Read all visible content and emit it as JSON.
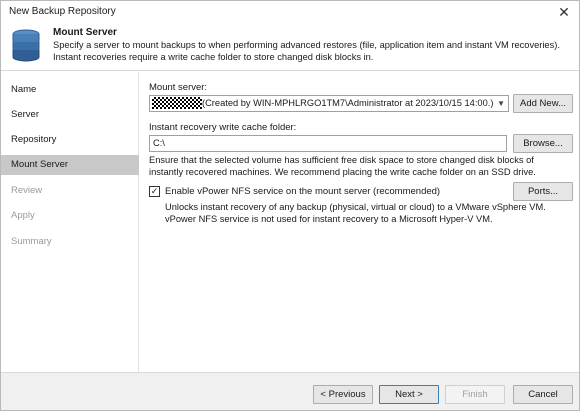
{
  "window": {
    "title": "New Backup Repository",
    "close_glyph": "✕"
  },
  "header": {
    "icon": "database-icon",
    "title": "Mount Server",
    "description": "Specify a server to mount backups to when performing advanced restores (file, application item and instant VM recoveries). Instant recoveries require a write cache folder to store changed disk blocks in."
  },
  "steps": [
    {
      "label": "Name",
      "state": "done"
    },
    {
      "label": "Server",
      "state": "done"
    },
    {
      "label": "Repository",
      "state": "done"
    },
    {
      "label": "Mount Server",
      "state": "active"
    },
    {
      "label": "Review",
      "state": "future"
    },
    {
      "label": "Apply",
      "state": "future"
    },
    {
      "label": "Summary",
      "state": "future"
    }
  ],
  "mount_server": {
    "label": "Mount server:",
    "selected_value": "(Created by WIN-MPHLRGO1TM7\\Administrator at 2023/10/15 14:00.)",
    "add_button": "Add New..."
  },
  "cache_folder": {
    "label": "Instant recovery write cache folder:",
    "value": "C:\\",
    "browse_button": "Browse...",
    "note": "Ensure that the selected volume has sufficient free disk space to store changed disk blocks of instantly recovered machines. We recommend placing the write cache folder on an SSD drive."
  },
  "nfs": {
    "checked": true,
    "check_glyph": "✓",
    "label": "Enable vPower NFS service on the mount server (recommended)",
    "ports_button": "Ports...",
    "note": "Unlocks instant recovery of any backup (physical, virtual or cloud) to a VMware vSphere VM. vPower NFS service is not used for instant recovery to a Microsoft Hyper-V VM."
  },
  "footer": {
    "previous": "< Previous",
    "next": "Next >",
    "finish": "Finish",
    "cancel": "Cancel"
  },
  "colors": {
    "active_step_bg": "#c8c8c8",
    "disabled_text": "#9a9a9a",
    "icon_blue": "#3b6fa8"
  }
}
